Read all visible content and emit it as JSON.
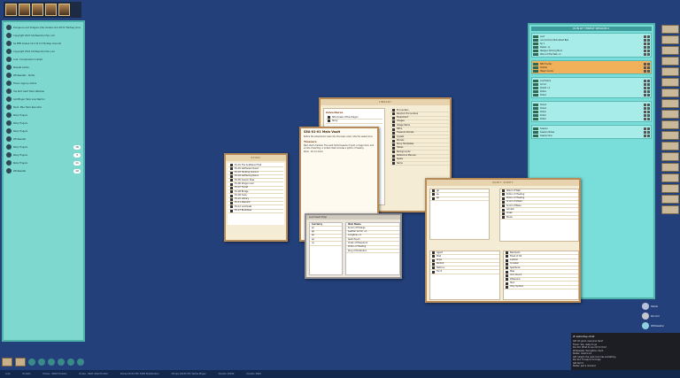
{
  "colors": {
    "desktop": "#23407a",
    "chat_panel": "#7fd8d0",
    "window_bg": "#f5ecd6",
    "window_border": "#b68b58",
    "highlight_group": "#f0b15a"
  },
  "topbar": {
    "portraits": [
      "portrait-1",
      "portrait-2",
      "portrait-3",
      "portrait-4",
      "portrait-5"
    ]
  },
  "chatlog": {
    "entries": [
      "Dungeons and Dragons (5e) loaded v4.0.18 for Fantasy Grounds",
      "Copyright 2021 Smiteworks USA, LLC",
      "5e PHB loaded v4.4.11 for Fantasy Grounds",
      "Copyright 2021 Smiteworks USA, LLC",
      "Loot. Compendium loaded",
      "Ruleset Active",
      "Whitewater - Smite",
      "Flavor Agency Active",
      "Yes Rich Gant Hack Attacker",
      "Goldfinger Hack Low Warrior",
      "Rook: Max Hack Recorder",
      "Ruby Fingers",
      "Ruby Fingers",
      "Ruby Fingers",
      "Whitewater",
      "Ruby Fingers",
      "Ruby Fingers",
      "Ruby Fingers",
      "Whitewater"
    ],
    "pills": [
      "16",
      "3",
      "11",
      "10",
      "3",
      "5"
    ]
  },
  "tray": {
    "buttons": [
      "tray-1",
      "tray-2"
    ]
  },
  "statusbar": {
    "items": [
      "Lore",
      "Dorado",
      "Dorse - 9942 Hunters",
      "Dorse - 9941 Shell Hunter",
      "Dorse 10132 5th 3448 Shellbroken",
      "Orlope 10232 5th Yellow Player",
      "Dorado 10032",
      "Dorado 4000"
    ]
  },
  "booklist": {
    "title": "RUN OF THREAT SESSION 1",
    "groups": [
      {
        "highlight": false,
        "rows": [
          "Loot",
          "(uncommon) Burnished Bell",
          "Sp 1",
          "Rapier +1",
          "Weapon Shining Mind",
          "Wand of the Web +1"
        ]
      },
      {
        "highlight": true,
        "rows": [
          "NPC Hunter",
          "Hostile",
          "Magic Goods"
        ]
      },
      {
        "highlight": false,
        "rows": [
          "Loot Items",
          "Armor",
          "Shield +1",
          "Potion",
          "Potion"
        ]
      },
      {
        "highlight": false,
        "rows": [
          "Sheet",
          "Sheet",
          "Potion",
          "Potion",
          "Potion"
        ]
      },
      {
        "highlight": false,
        "rows": [
          "Session",
          "Session Notes",
          "Session Run"
        ]
      }
    ]
  },
  "sidetabs": [
    "tab-1",
    "tab-2",
    "tab-3",
    "tab-4",
    "tab-5",
    "tab-6",
    "tab-7",
    "tab-8",
    "tab-9",
    "tab-10",
    "tab-11",
    "tab-12",
    "tab-13",
    "tab-14",
    "tab-15",
    "tab-16",
    "tab-17",
    "tab-18"
  ],
  "library": {
    "title": "LIBRARY",
    "left_heading": "Adventures",
    "left_items": [
      "SEA Quest of the Dragon",
      "Story"
    ],
    "right_items": [
      "Encounters",
      "Random Encounters",
      "Equipment",
      "Images",
      "Image Items",
      "NPCs",
      "Treasure Parcels",
      "Quests",
      "Parcels",
      "Story Templates",
      "Tables",
      "Backgrounds",
      "Reference Manual",
      "Spells",
      "Items"
    ]
  },
  "story": {
    "title": "STORY",
    "rows": [
      "E1-01 The Scattered Trail",
      "E1-02 Gathered Quest",
      "E1-03 Hunting Ground",
      "E1-04 Gathering Ruins",
      "E1-05 Cavern Pass",
      "E1-06 Dragon Lair",
      "E1-07 Forest",
      "E1-08 Bridge",
      "E1-09 Cave",
      "E1-10 Library",
      "E1-11 Descent",
      "E1-12 Lost Gate",
      "E1-13 Brambles"
    ]
  },
  "record": {
    "heading": "SEA-01-01 Main Vault",
    "intro": "Before the adventurers head into the lower vault, note the sealed door.",
    "section": "Treasure",
    "body": "Main Vault chamber. The vault holds treasure of gold, a magic item, and scrolls of warding. A locked chest includes a potion of healing.",
    "npc": "Monk - DC 12 check"
  },
  "loot": {
    "title": "Loot Vault Drop",
    "left_header": "Currency",
    "left_rows": [
      "sp",
      "gp",
      "ep",
      "pp",
      "cp"
    ],
    "right_header": "Item Name",
    "right_rows": [
      "Scroll of Enlarge",
      "Leather Armor +1",
      "Longbow +1",
      "Spell Pouch",
      "Cloak of Elvenkind",
      "Potion of Healing",
      "Ring of Protection"
    ]
  },
  "party": {
    "title": "PARTY SHEET",
    "left_rows": [
      "gp",
      "sp",
      "ep"
    ],
    "right_rows": [
      "Wand of Web",
      "Potion of Healing",
      "Potion of Healing",
      "Scroll of Shield",
      "Scroll of Bless",
      "Amulet",
      "Cloak",
      "Boots"
    ],
    "bottom_rows": [
      "Agent",
      "Mist",
      "Rope",
      "Bedroll",
      "Rations",
      "Torch"
    ],
    "bottom_right": [
      "Backpack",
      "Flask of Oil",
      "Lantern",
      "Crowbar",
      "Spellbook",
      "Map",
      "Coin Pouch",
      "Waterskin",
      "Tent",
      "Holy Symbol"
    ]
  },
  "users": [
    {
      "name": "Stellar",
      "color": "#b8bfd8"
    },
    {
      "name": "Pan Kid",
      "color": "#c5c5cc"
    },
    {
      "name": "Whitewater",
      "color": "#8fd0e0"
    }
  ],
  "chatwin": {
    "channel": "# saturday-chat",
    "lines": [
      "GM: Ok good, everyone here?",
      "Flavor: Yep, ready to go",
      "Pan Kid: What do we roll for this?",
      "Whitewater: Perception check",
      "Stellar: rolled a 14",
      "GM: Alright, the next room has something",
      "Pan Kid: I'll search for traps",
      "GM: Roll it",
      "Stellar: Just a moment"
    ]
  }
}
